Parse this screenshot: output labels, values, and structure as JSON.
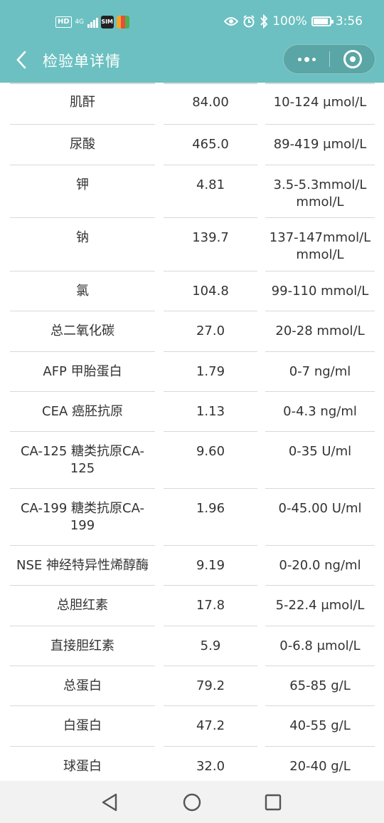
{
  "status_bar": {
    "hd": "HD",
    "network": "4G",
    "app1": "SIM",
    "battery": "100%",
    "battery_level": 1.0,
    "time": "3:56"
  },
  "nav": {
    "title": "检验单详情"
  },
  "colors": {
    "header_bg": "#6cc0c1",
    "divider": "#d9d9d9",
    "text": "#333333",
    "bottom_bar": "#f2f2f2"
  },
  "results": [
    {
      "name": "肌酐",
      "value": "84.00",
      "ref": "10-124 μmol/L"
    },
    {
      "name": "尿酸",
      "value": "465.0",
      "ref": "89-419 μmol/L"
    },
    {
      "name": "钾",
      "value": "4.81",
      "ref": "3.5-5.3mmol/L mmol/L"
    },
    {
      "name": "钠",
      "value": "139.7",
      "ref": "137-147mmol/L mmol/L"
    },
    {
      "name": "氯",
      "value": "104.8",
      "ref": "99-110 mmol/L"
    },
    {
      "name": "总二氧化碳",
      "value": "27.0",
      "ref": "20-28 mmol/L"
    },
    {
      "name": "AFP 甲胎蛋白",
      "value": "1.79",
      "ref": "0-7 ng/ml"
    },
    {
      "name": "CEA 癌胚抗原",
      "value": "1.13",
      "ref": "0-4.3 ng/ml"
    },
    {
      "name": "CA-125 糖类抗原CA-125",
      "value": "9.60",
      "ref": "0-35 U/ml"
    },
    {
      "name": "CA-199 糖类抗原CA-199",
      "value": "1.96",
      "ref": "0-45.00 U/ml"
    },
    {
      "name": "NSE 神经特异性烯醇酶",
      "value": "9.19",
      "ref": "0-20.0 ng/ml"
    },
    {
      "name": "总胆红素",
      "value": "17.8",
      "ref": "5-22.4 μmol/L"
    },
    {
      "name": "直接胆红素",
      "value": "5.9",
      "ref": "0-6.8 μmol/L"
    },
    {
      "name": "总蛋白",
      "value": "79.2",
      "ref": "65-85 g/L"
    },
    {
      "name": "白蛋白",
      "value": "47.2",
      "ref": "40-55 g/L"
    },
    {
      "name": "球蛋白",
      "value": "32.0",
      "ref": "20-40 g/L"
    }
  ]
}
